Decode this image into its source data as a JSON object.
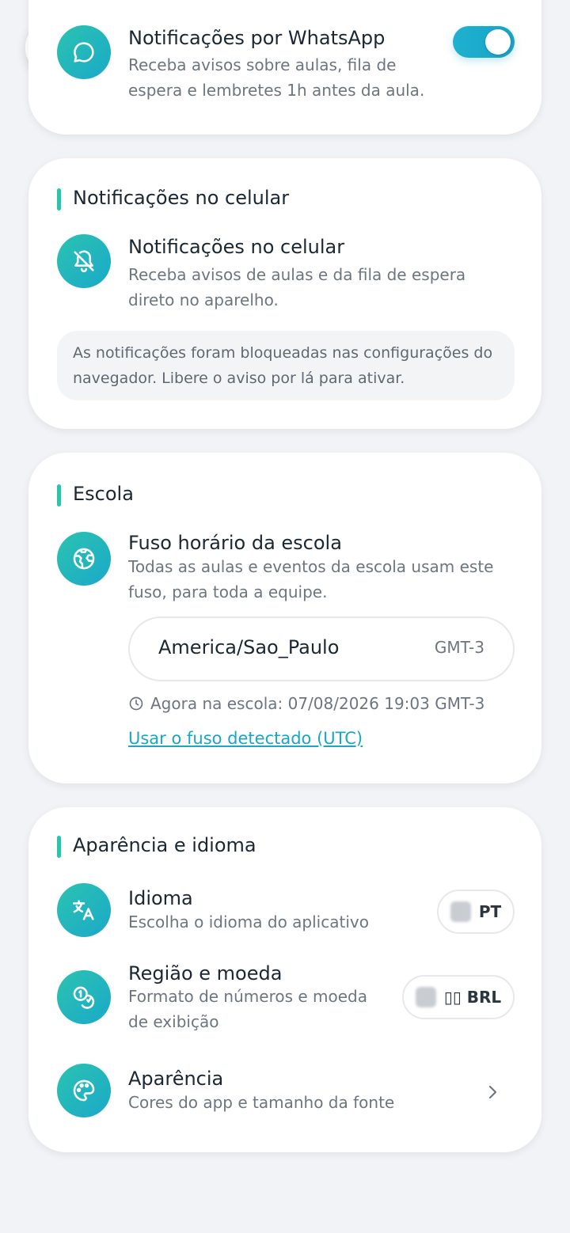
{
  "whatsapp": {
    "title": "Notificações por WhatsApp",
    "description": "Receba avisos sobre aulas, fila de espera e lembretes 1h antes da aula.",
    "enabled": true,
    "icon": "chat-bubble-icon"
  },
  "phone_notifications": {
    "section_title": "Notificações no celular",
    "title": "Notificações no celular",
    "description": "Receba avisos de aulas e da fila de espera direto no aparelho.",
    "notice": "As notificações foram bloqueadas nas configurações do navegador. Libere o aviso por lá para ativar.",
    "icon": "bell-off-icon"
  },
  "school": {
    "section_title": "Escola",
    "timezone_title": "Fuso horário da escola",
    "timezone_description": "Todas as aulas e eventos da escola usam este fuso, para toda a equipe.",
    "timezone_value": "America/Sao_Paulo",
    "timezone_offset": "GMT-3",
    "now_text": "Agora na escola: 07/08/2026 19:03 GMT-3",
    "detected_link": "Usar o fuso detectado (UTC)",
    "icon": "globe-icon"
  },
  "appearance": {
    "section_title": "Aparência e idioma",
    "language_title": "Idioma",
    "language_description": "Escolha o idioma do aplicativo",
    "language_value": "PT",
    "region_title": "Região e moeda",
    "region_description": "Formato de números e moeda de exibição",
    "region_value": "▯▯ BRL",
    "theme_title": "Aparência",
    "theme_description": "Cores do app e tamanho da fonte"
  },
  "colors": {
    "accent": "#26c6ad",
    "primary": "#18a8c4"
  }
}
